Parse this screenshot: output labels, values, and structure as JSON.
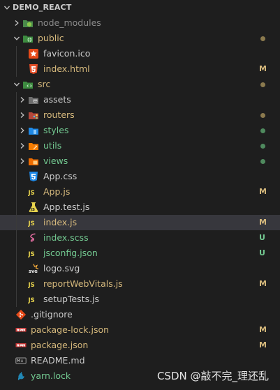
{
  "explorer": {
    "root_label": "DEMO_REACT",
    "watermark": "CSDN @敲不完_理还乱",
    "colors": {
      "modified": "#d7ba7d",
      "untracked": "#73c991",
      "ignored": "#8b8b8b",
      "normal": "#cccccc",
      "selected_bg": "#37373d"
    },
    "items": [
      {
        "label": "node_modules",
        "kind": "folder",
        "expanded": false,
        "depth": 0,
        "icon": "node-folder-icon",
        "color": "dim",
        "status": "",
        "dot": ""
      },
      {
        "label": "public",
        "kind": "folder",
        "expanded": true,
        "depth": 0,
        "icon": "public-folder-icon",
        "color": "mod",
        "status": "",
        "dot": "mod"
      },
      {
        "label": "favicon.ico",
        "kind": "file",
        "depth": 1,
        "icon": "favicon-icon",
        "color": "norm",
        "status": "",
        "dot": ""
      },
      {
        "label": "index.html",
        "kind": "file",
        "depth": 1,
        "icon": "html5-icon",
        "color": "mod",
        "status": "M",
        "dot": ""
      },
      {
        "label": "src",
        "kind": "folder",
        "expanded": true,
        "depth": 0,
        "icon": "src-folder-icon",
        "color": "mod",
        "status": "",
        "dot": "mod"
      },
      {
        "label": "assets",
        "kind": "folder",
        "expanded": false,
        "depth": 1,
        "icon": "assets-folder-icon",
        "color": "norm",
        "status": "",
        "dot": ""
      },
      {
        "label": "routers",
        "kind": "folder",
        "expanded": false,
        "depth": 1,
        "icon": "routers-folder-icon",
        "color": "mod",
        "status": "",
        "dot": "mod"
      },
      {
        "label": "styles",
        "kind": "folder",
        "expanded": false,
        "depth": 1,
        "icon": "styles-folder-icon",
        "color": "untr",
        "status": "",
        "dot": "untr"
      },
      {
        "label": "utils",
        "kind": "folder",
        "expanded": false,
        "depth": 1,
        "icon": "utils-folder-icon",
        "color": "untr",
        "status": "",
        "dot": "untr"
      },
      {
        "label": "views",
        "kind": "folder",
        "expanded": false,
        "depth": 1,
        "icon": "views-folder-icon",
        "color": "untr",
        "status": "",
        "dot": "untr"
      },
      {
        "label": "App.css",
        "kind": "file",
        "depth": 1,
        "icon": "css3-icon",
        "color": "norm",
        "status": "",
        "dot": ""
      },
      {
        "label": "App.js",
        "kind": "file",
        "depth": 1,
        "icon": "javascript-icon",
        "color": "mod",
        "status": "M",
        "dot": ""
      },
      {
        "label": "App.test.js",
        "kind": "file",
        "depth": 1,
        "icon": "test-js-icon",
        "color": "norm",
        "status": "",
        "dot": ""
      },
      {
        "label": "index.js",
        "kind": "file",
        "depth": 1,
        "icon": "javascript-icon",
        "color": "mod",
        "status": "M",
        "dot": "",
        "selected": true
      },
      {
        "label": "index.scss",
        "kind": "file",
        "depth": 1,
        "icon": "sass-icon",
        "color": "untr",
        "status": "U",
        "dot": ""
      },
      {
        "label": "jsconfig.json",
        "kind": "file",
        "depth": 1,
        "icon": "jsconfig-icon",
        "color": "untr",
        "status": "U",
        "dot": ""
      },
      {
        "label": "logo.svg",
        "kind": "file",
        "depth": 1,
        "icon": "svg-icon",
        "color": "norm",
        "status": "",
        "dot": ""
      },
      {
        "label": "reportWebVitals.js",
        "kind": "file",
        "depth": 1,
        "icon": "javascript-icon",
        "color": "mod",
        "status": "M",
        "dot": ""
      },
      {
        "label": "setupTests.js",
        "kind": "file",
        "depth": 1,
        "icon": "javascript-icon",
        "color": "norm",
        "status": "",
        "dot": ""
      },
      {
        "label": ".gitignore",
        "kind": "file",
        "depth": 0,
        "icon": "git-icon",
        "color": "norm",
        "status": "",
        "dot": ""
      },
      {
        "label": "package-lock.json",
        "kind": "file",
        "depth": 0,
        "icon": "npm-icon",
        "color": "mod",
        "status": "M",
        "dot": ""
      },
      {
        "label": "package.json",
        "kind": "file",
        "depth": 0,
        "icon": "npm-icon",
        "color": "mod",
        "status": "M",
        "dot": ""
      },
      {
        "label": "README.md",
        "kind": "file",
        "depth": 0,
        "icon": "markdown-icon",
        "color": "norm",
        "status": "",
        "dot": ""
      },
      {
        "label": "yarn.lock",
        "kind": "file",
        "depth": 0,
        "icon": "yarn-icon",
        "color": "untr",
        "status": "",
        "dot": ""
      }
    ]
  }
}
